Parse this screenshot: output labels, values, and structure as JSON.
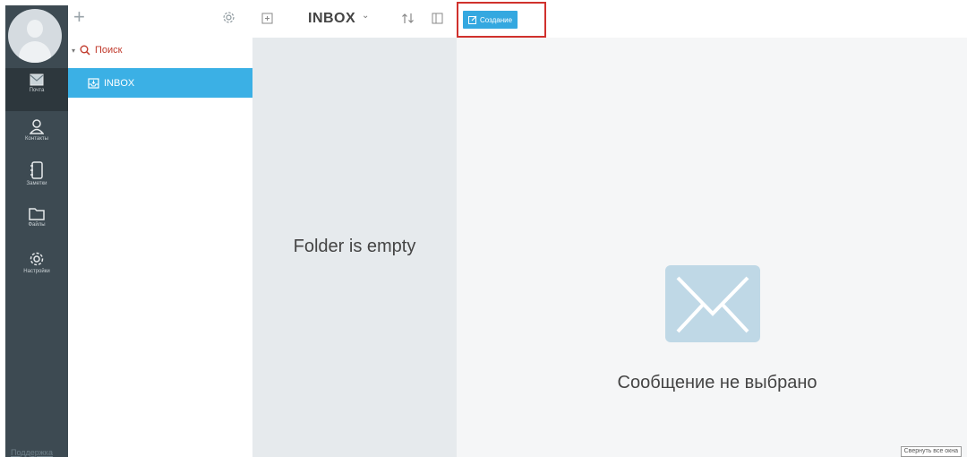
{
  "sidebar": {
    "items": [
      {
        "icon": "mail-icon",
        "label": "Почта"
      },
      {
        "icon": "contacts-icon",
        "label": "Контакты"
      },
      {
        "icon": "notes-icon",
        "label": "Заметки"
      },
      {
        "icon": "folder-icon",
        "label": "Файлы"
      },
      {
        "icon": "gear-icon",
        "label": "Настройки"
      }
    ],
    "support_label": "Поддержка"
  },
  "folders": {
    "add_label": "+",
    "search_label": "Поиск",
    "inbox_label": "INBOX"
  },
  "toolbar": {
    "folder_title": "INBOX",
    "compose_label": "Создание"
  },
  "list": {
    "empty_text": "Folder is empty"
  },
  "viewer": {
    "empty_text": "Сообщение не выбрано",
    "collapse_label": "Свернуть все окна"
  },
  "colors": {
    "rail": "#3d4a52",
    "accent": "#3bb0e5",
    "highlight_frame": "#d0312d"
  }
}
